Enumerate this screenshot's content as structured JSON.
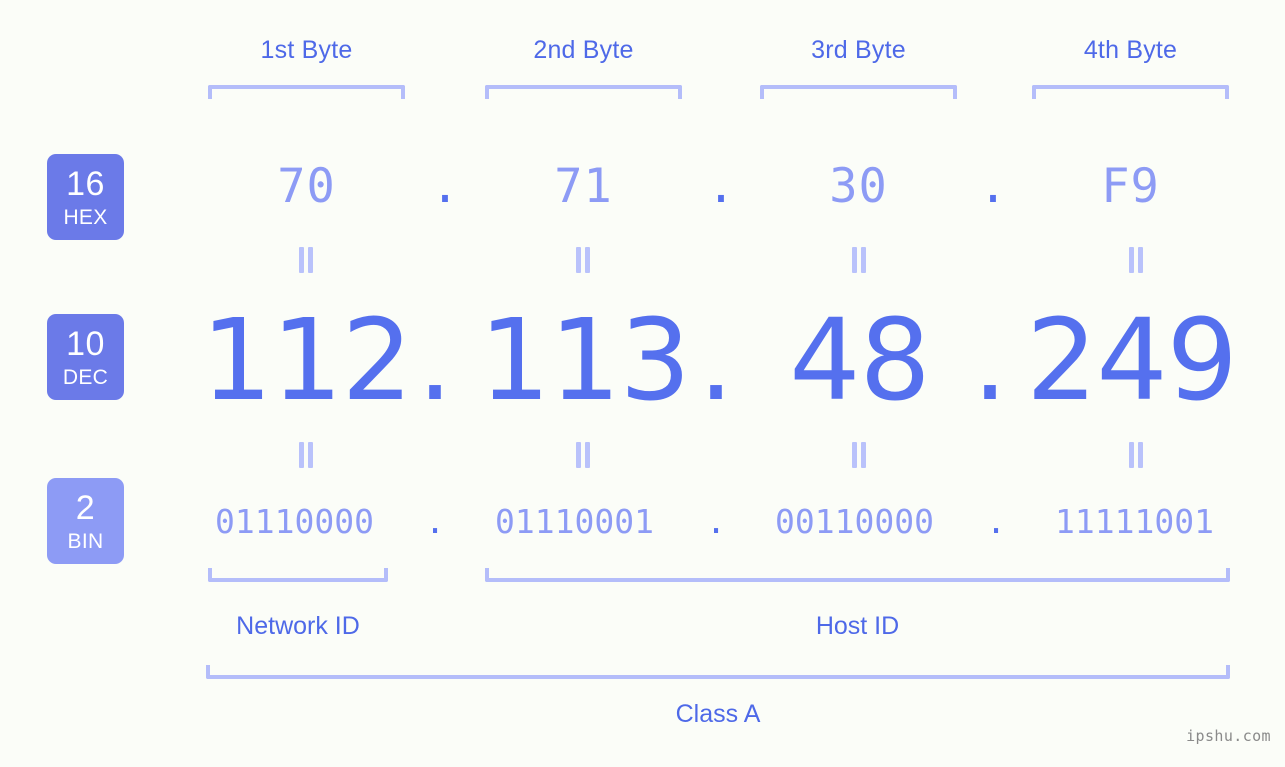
{
  "meta": {
    "background_color": "#fbfdf8",
    "accent_strong": "#5570ee",
    "accent_mid": "#4e69e8",
    "accent_light": "#8d9bf5",
    "bracket_color": "#b4bdfa",
    "watermark": "ipshu.com"
  },
  "byte_headers": [
    {
      "label": "1st Byte"
    },
    {
      "label": "2nd Byte"
    },
    {
      "label": "3rd Byte"
    },
    {
      "label": "4th Byte"
    }
  ],
  "rows": [
    {
      "key": "hex",
      "badge": {
        "base": "16",
        "label": "HEX",
        "color": "#6b7ae8"
      },
      "values": [
        "70",
        "71",
        "30",
        "F9"
      ],
      "separator": "."
    },
    {
      "key": "dec",
      "badge": {
        "base": "10",
        "label": "DEC",
        "color": "#6b7ae8"
      },
      "values": [
        "112",
        "113",
        "48",
        "249"
      ],
      "separator": "."
    },
    {
      "key": "bin",
      "badge": {
        "base": "2",
        "label": "BIN",
        "color": "#8d9bf5"
      },
      "values": [
        "01110000",
        "01110001",
        "00110000",
        "11111001"
      ],
      "separator": "."
    }
  ],
  "equals_symbol": "=",
  "segments": {
    "network_id": "Network ID",
    "host_id": "Host ID"
  },
  "class_label": "Class A"
}
